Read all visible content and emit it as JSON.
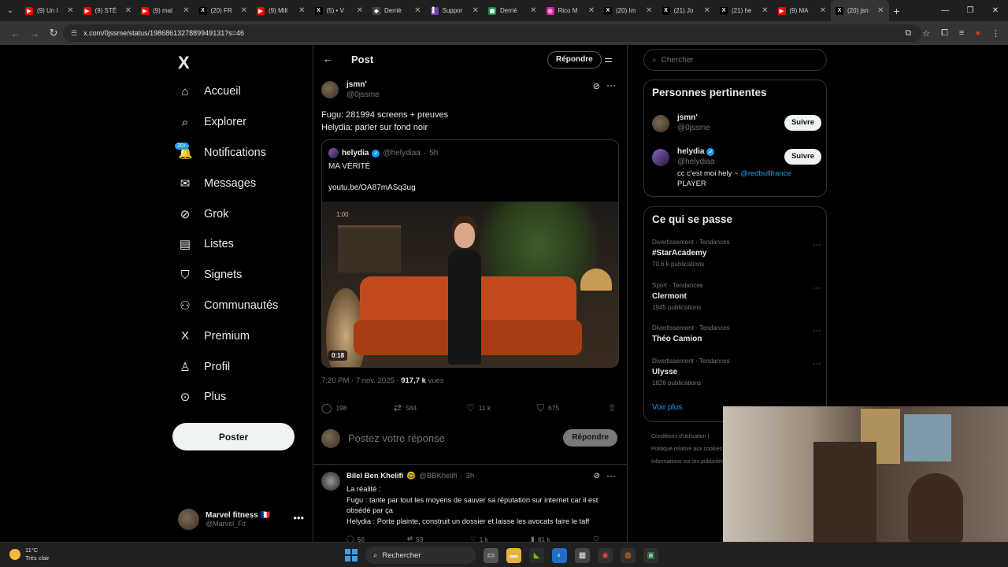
{
  "browser": {
    "tabs": [
      {
        "label": "(9) Un l",
        "color": "#ff0000",
        "glyph": "▶"
      },
      {
        "label": "(9) STÉ",
        "color": "#ff0000",
        "glyph": "▶"
      },
      {
        "label": "(9) mal",
        "color": "#ff0000",
        "glyph": "▶"
      },
      {
        "label": "(20) FR",
        "color": "#000000",
        "glyph": "X"
      },
      {
        "label": "(9) Mill",
        "color": "#ff0000",
        "glyph": "▶"
      },
      {
        "label": "(5) • V",
        "color": "#000000",
        "glyph": "X"
      },
      {
        "label": "Derriè",
        "color": "#444444",
        "glyph": "◆"
      },
      {
        "label": "Suppor",
        "color": "#7b3fb8",
        "glyph": "▌"
      },
      {
        "label": "Derriè",
        "color": "#1f8a4c",
        "glyph": "▦"
      },
      {
        "label": "Rico M",
        "color": "#d6249f",
        "glyph": "◎"
      },
      {
        "label": "(20) Im",
        "color": "#000000",
        "glyph": "X"
      },
      {
        "label": "(21) Jo",
        "color": "#000000",
        "glyph": "X"
      },
      {
        "label": "(21) he",
        "color": "#000000",
        "glyph": "X"
      },
      {
        "label": "(9) MA",
        "color": "#ff0000",
        "glyph": "▶"
      },
      {
        "label": "(20) jsn",
        "color": "#000000",
        "glyph": "X",
        "active": true
      }
    ],
    "url": "x.com/0jssme/status/1986861327889949131?s=46"
  },
  "nav": {
    "logo": "X",
    "items": [
      {
        "label": "Accueil",
        "icon": "home-icon",
        "glyph": "⌂"
      },
      {
        "label": "Explorer",
        "icon": "search-icon",
        "glyph": "⌕"
      },
      {
        "label": "Notifications",
        "icon": "bell-icon",
        "glyph": "🔔",
        "badge": "20+"
      },
      {
        "label": "Messages",
        "icon": "mail-icon",
        "glyph": "✉"
      },
      {
        "label": "Grok",
        "icon": "grok-icon",
        "glyph": "⊘"
      },
      {
        "label": "Listes",
        "icon": "list-icon",
        "glyph": "▤"
      },
      {
        "label": "Signets",
        "icon": "bookmark-icon",
        "glyph": "⛉"
      },
      {
        "label": "Communautés",
        "icon": "communities-icon",
        "glyph": "⚇"
      },
      {
        "label": "Premium",
        "icon": "premium-icon",
        "glyph": "X"
      },
      {
        "label": "Profil",
        "icon": "profile-icon",
        "glyph": "♙"
      },
      {
        "label": "Plus",
        "icon": "more-circle-icon",
        "glyph": "⊙"
      }
    ],
    "post_button": "Poster",
    "account": {
      "name": "Marvel fitness 🇫🇷",
      "handle": "@Marvel_Fit"
    }
  },
  "header": {
    "title": "Post",
    "reply_button": "Répondre"
  },
  "post": {
    "author_name": "jsmn'",
    "author_handle": "@0jssme",
    "text_line1": "Fugu: 281994 screens + preuves",
    "text_line2": "Helydia: parler sur fond noir",
    "quote": {
      "name": "helydia",
      "handle": "@helydiaa",
      "time": "5h",
      "text": "MA VÉRITÉ",
      "link": "youtu.be/OA87mASq3ug",
      "video_timestamp": "1:00",
      "video_duration": "0:18"
    },
    "meta_time": "7:20 PM · 7 nov. 2025 · ",
    "meta_views": "917,7 k",
    "meta_views_label": " vues",
    "stats": {
      "replies": "198",
      "reposts": "584",
      "likes": "11 k",
      "bookmarks": "675"
    }
  },
  "composer": {
    "placeholder": "Postez votre réponse",
    "button": "Répondre"
  },
  "reply": {
    "name": "Bilel Ben Khelifi",
    "emoji": "🤓",
    "handle": "@BBKhelifi",
    "time": "3h",
    "line1": "La réalité :",
    "line2": "Fugu : tante par tout les moyens de sauver sa réputation sur internet car il est obsédé par ça",
    "line3": "Helydia : Porte plainte, construit un dossier et laisse les avocats faire le taff",
    "stats": {
      "replies": "56",
      "reposts": "59",
      "likes": "1 k",
      "views": "81 k"
    }
  },
  "sidebar": {
    "search_placeholder": "Chercher",
    "relevant_title": "Personnes pertinentes",
    "people": [
      {
        "name": "jsmn'",
        "handle": "@0jssme",
        "follow": "Suivre",
        "bio": ""
      },
      {
        "name": "helydia",
        "handle": "@helydiaa",
        "follow": "Suivre",
        "bio": "cc c'est moi hely ~ ",
        "bio_link": "@redbullfrance",
        "bio_end": "PLAYER"
      }
    ],
    "trends_title": "Ce qui se passe",
    "trends": [
      {
        "category": "Divertissement · Tendances",
        "title": "#StarAcademy",
        "count": "70,6 k publications"
      },
      {
        "category": "Sport · Tendances",
        "title": "Clermont",
        "count": "1945 publications"
      },
      {
        "category": "Divertissement · Tendances",
        "title": "Théo Camion",
        "count": ""
      },
      {
        "category": "Divertissement · Tendances",
        "title": "Ulysse",
        "count": "1826 publications"
      }
    ],
    "see_more": "Voir plus",
    "footer": [
      "Conditions d'utilisation  |",
      "Politique relative aux cookies",
      "Informations sur les publicités"
    ]
  },
  "taskbar": {
    "temp": "11°C",
    "weather": "Très clair",
    "search": "Rechercher"
  }
}
